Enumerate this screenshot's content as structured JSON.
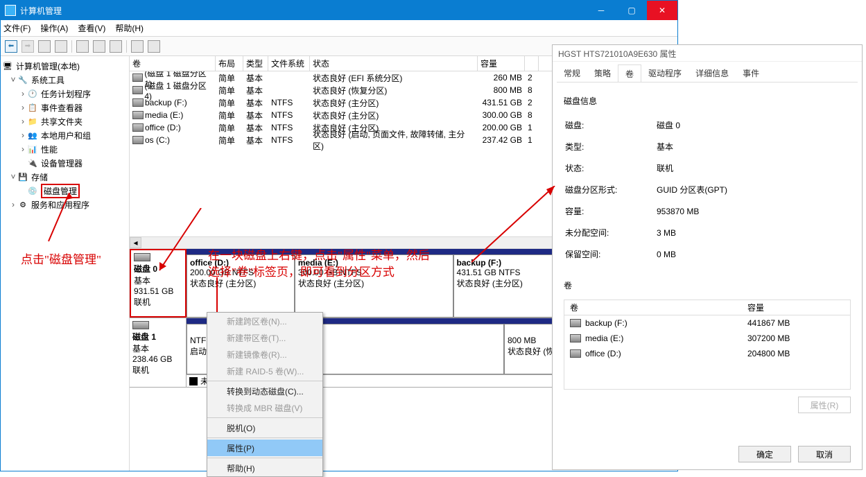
{
  "titlebar": {
    "title": "计算机管理"
  },
  "menubar": [
    "文件(F)",
    "操作(A)",
    "查看(V)",
    "帮助(H)"
  ],
  "tree": {
    "root": "计算机管理(本地)",
    "systools": "系统工具",
    "nodes": [
      "任务计划程序",
      "事件查看器",
      "共享文件夹",
      "本地用户和组",
      "性能",
      "设备管理器"
    ],
    "storage": "存储",
    "diskmgmt": "磁盘管理",
    "services": "服务和应用程序"
  },
  "vl": {
    "headers": {
      "name": "卷",
      "layout": "布局",
      "type": "类型",
      "fs": "文件系统",
      "status": "状态",
      "cap": "容量"
    },
    "rows": [
      {
        "n": "(磁盘 1 磁盘分区 1)",
        "l": "简单",
        "t": "基本",
        "f": "",
        "s": "状态良好 (EFI 系统分区)",
        "c": "260 MB",
        "r": "2"
      },
      {
        "n": "(磁盘 1 磁盘分区 4)",
        "l": "简单",
        "t": "基本",
        "f": "",
        "s": "状态良好 (恢复分区)",
        "c": "800 MB",
        "r": "8"
      },
      {
        "n": "backup (F:)",
        "l": "简单",
        "t": "基本",
        "f": "NTFS",
        "s": "状态良好 (主分区)",
        "c": "431.51 GB",
        "r": "2"
      },
      {
        "n": "media (E:)",
        "l": "简单",
        "t": "基本",
        "f": "NTFS",
        "s": "状态良好 (主分区)",
        "c": "300.00 GB",
        "r": "8"
      },
      {
        "n": "office (D:)",
        "l": "简单",
        "t": "基本",
        "f": "NTFS",
        "s": "状态良好 (主分区)",
        "c": "200.00 GB",
        "r": "1"
      },
      {
        "n": "os (C:)",
        "l": "简单",
        "t": "基本",
        "f": "NTFS",
        "s": "状态良好 (启动, 页面文件, 故障转储, 主分区)",
        "c": "237.42 GB",
        "r": "1"
      }
    ]
  },
  "disk0": {
    "title": "磁盘 0",
    "type": "基本",
    "size": "931.51 GB",
    "status": "联机",
    "parts": [
      {
        "n": "office  (D:)",
        "sz": "200.00 GB NTFS",
        "st": "状态良好 (主分区)"
      },
      {
        "n": "media  (E:)",
        "sz": "300.00 GB NTFS",
        "st": "状态良好 (主分区)"
      },
      {
        "n": "backup  (F:)",
        "sz": "431.51 GB NTFS",
        "st": "状态良好 (主分区)"
      }
    ]
  },
  "disk1": {
    "title": "磁盘 1",
    "type": "基本",
    "size": "238.46 GB",
    "status": "联机",
    "parts": [
      {
        "n": "",
        "sz": "",
        "st": "NTFS\n启动, 页面文件, 故障转储,"
      },
      {
        "n": "",
        "sz": "800 MB",
        "st": "状态良好 (恢复分区"
      }
    ],
    "unalloc": "未分配"
  },
  "ctx": {
    "items": [
      "新建跨区卷(N)...",
      "新建带区卷(T)...",
      "新建镜像卷(R)...",
      "新建 RAID-5 卷(W)...",
      "转换到动态磁盘(C)...",
      "转换成 MBR 磁盘(V)",
      "脱机(O)",
      "属性(P)",
      "帮助(H)"
    ]
  },
  "annot1": "点击\"磁盘管理\"",
  "annot2a": "在一块磁盘上右键，点击\"属性\"菜单，然后",
  "annot2b": "选择\"卷\"标签页，即可看到分区方式",
  "dlg": {
    "title": "HGST HTS721010A9E630 属性",
    "tabs": [
      "常规",
      "策略",
      "卷",
      "驱动程序",
      "详细信息",
      "事件"
    ],
    "section": "磁盘信息",
    "rows": [
      [
        "磁盘:",
        "磁盘 0"
      ],
      [
        "类型:",
        "基本"
      ],
      [
        "状态:",
        "联机"
      ],
      [
        "磁盘分区形式:",
        "GUID 分区表(GPT)"
      ],
      [
        "容量:",
        "953870 MB"
      ],
      [
        "未分配空间:",
        "3 MB"
      ],
      [
        "保留空间:",
        "0 MB"
      ]
    ],
    "volsection": "卷",
    "volhead": [
      "卷",
      "容量"
    ],
    "vols": [
      [
        "backup (F:)",
        "441867 MB"
      ],
      [
        "media (E:)",
        "307200 MB"
      ],
      [
        "office (D:)",
        "204800 MB"
      ]
    ],
    "propbtn": "属性(R)",
    "ok": "确定",
    "cancel": "取消"
  }
}
